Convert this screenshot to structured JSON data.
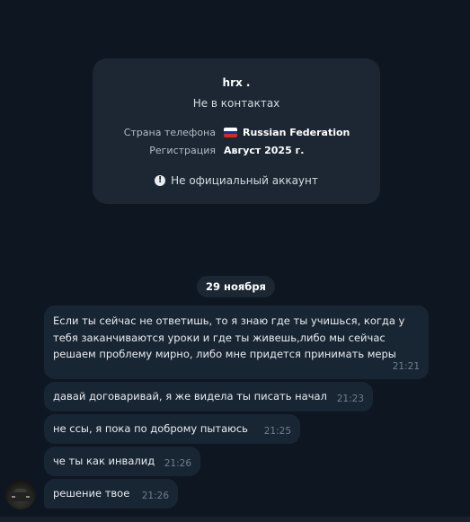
{
  "contact_card": {
    "name": "hrx .",
    "status": "Не в контактах",
    "rows": [
      {
        "label": "Страна телефона",
        "value": "Russian Federation",
        "flag_colors": [
          "#ffffff",
          "#0039a6",
          "#d52b1e"
        ]
      },
      {
        "label": "Регистрация",
        "value": "Август 2025 г."
      }
    ],
    "notice_icon": "exclamation-circle-icon",
    "notice": "Не официальный аккаунт"
  },
  "date_divider": "29 ноября",
  "messages": [
    {
      "text": "Если ты сейчас не ответишь, то я знаю где ты учишься, когда у\nтебя заканчиваются уроки и где ты живешь,либо мы сейчас\nрешаем проблему мирно, либо мне придется принимать меры",
      "time": "21:21"
    },
    {
      "text": "давай договаривай, я же видела ты писать начал",
      "time": "21:23"
    },
    {
      "text": "не ссы, я пока по доброму пытаюсь",
      "time": "21:25"
    },
    {
      "text": "че ты как инвалид",
      "time": "21:26"
    },
    {
      "text": "решение твое",
      "time": "21:26"
    }
  ],
  "colors": {
    "background": "#0e1621",
    "card": "#1c2733",
    "bubble": "#182533",
    "time": "#6d7f8f"
  }
}
